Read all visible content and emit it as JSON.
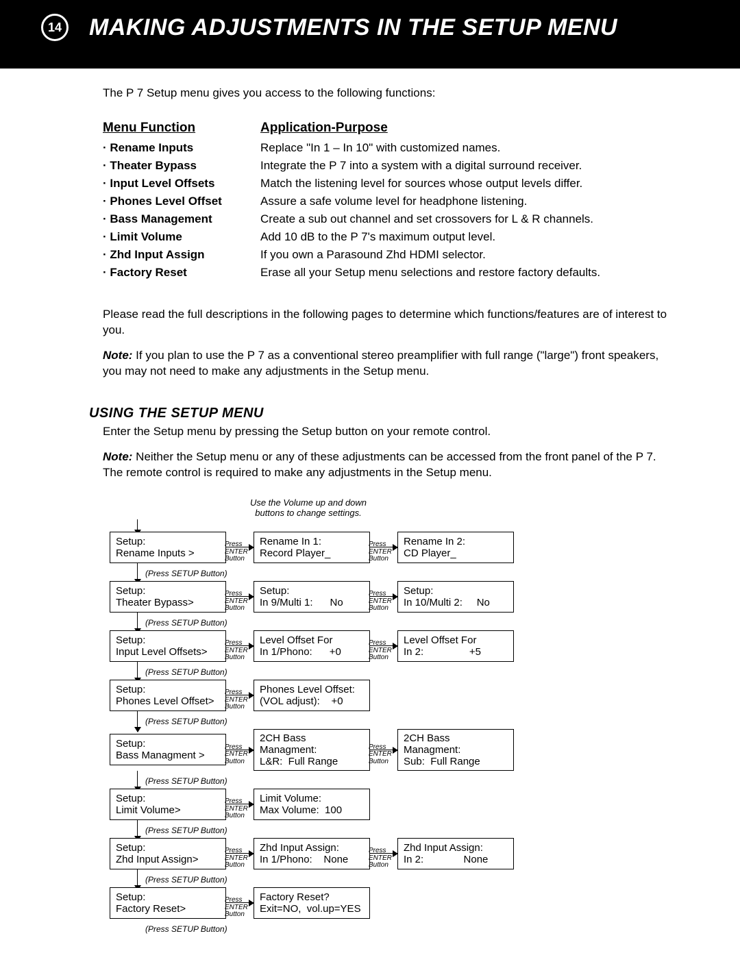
{
  "page_number": "14",
  "header_title": "MAKING ADJUSTMENTS IN THE SETUP MENU",
  "intro": "The P 7 Setup menu gives you access to the following functions:",
  "table": {
    "col1_header": "Menu Function",
    "col2_header": "Application-Purpose",
    "rows": [
      {
        "func": "· Rename Inputs",
        "purpose": "Replace \"In 1 – In 10\" with customized names."
      },
      {
        "func": "· Theater Bypass",
        "purpose": "Integrate the P 7 into a system with a digital surround receiver."
      },
      {
        "func": "· Input Level Offsets",
        "purpose": "Match the listening level for sources whose output levels differ."
      },
      {
        "func": "· Phones Level Offset",
        "purpose": "Assure a safe volume level for headphone listening."
      },
      {
        "func": "· Bass Management",
        "purpose": "Create a sub out channel and set crossovers for L & R channels."
      },
      {
        "func": "· Limit Volume",
        "purpose": "Add 10 dB to the P 7's maximum output level."
      },
      {
        "func": "· Zhd Input Assign",
        "purpose": "If you own a Parasound Zhd HDMI selector."
      },
      {
        "func": "· Factory Reset",
        "purpose": "Erase all your Setup menu selections and restore factory defaults."
      }
    ]
  },
  "para1": "Please read the full descriptions in the following pages to determine which functions/features are of interest to you.",
  "note1_label": "Note:",
  "note1_text": " If you plan to use the P 7 as a conventional stereo preamplifier with full range (\"large\") front speakers, you may not need to make any adjustments in the Setup menu.",
  "section2_heading": "USING THE SETUP MENU",
  "section2_p1": "Enter the Setup menu by pressing the Setup button on your remote control.",
  "note2_label": "Note:",
  "note2_text": " Neither the Setup menu or any of these adjustments can be accessed from the front panel of the P 7. The remote control is required to make any adjustments in the Setup menu.",
  "diagram": {
    "top_hint": "Use the Volume up and down buttons to change settings.",
    "enter_label_l1": "Press",
    "enter_label_l2": "ENTER",
    "enter_label_l3": "Button",
    "setup_label": "(Press SETUP Button)",
    "rows": [
      {
        "col1": {
          "l1": "Setup:",
          "l2": "Rename Inputs >"
        },
        "col2": {
          "l1": "Rename In 1:",
          "l2": "Record Player_"
        },
        "col3": {
          "l1": "Rename In 2:",
          "l2": "CD Player_"
        }
      },
      {
        "col1": {
          "l1": "Setup:",
          "l2": "Theater Bypass>"
        },
        "col2": {
          "l1": "Setup:",
          "l2": "In 9/Multi 1:      No"
        },
        "col3": {
          "l1": "Setup:",
          "l2": "In 10/Multi 2:     No"
        }
      },
      {
        "col1": {
          "l1": "Setup:",
          "l2": "Input Level Offsets>"
        },
        "col2": {
          "l1": "Level Offset For",
          "l2": "In 1/Phono:      +0"
        },
        "col3": {
          "l1": "Level Offset For",
          "l2": "In 2:                +5"
        }
      },
      {
        "col1": {
          "l1": "Setup:",
          "l2": "Phones Level Offset>"
        },
        "col2": {
          "l1": "Phones Level Offset:",
          "l2": "(VOL adjust):    +0"
        },
        "col3": null
      },
      {
        "col1": {
          "l1": "Setup:",
          "l2": "Bass Managment >"
        },
        "col2": {
          "l1": "2CH Bass Managment:",
          "l2": "L&R:  Full Range"
        },
        "col3": {
          "l1": "2CH Bass Managment:",
          "l2": "Sub:  Full Range"
        }
      },
      {
        "col1": {
          "l1": "Setup:",
          "l2": "Limit Volume>"
        },
        "col2": {
          "l1": "Limit Volume:",
          "l2": "Max Volume:  100"
        },
        "col3": null
      },
      {
        "col1": {
          "l1": "Setup:",
          "l2": "Zhd Input Assign>"
        },
        "col2": {
          "l1": "Zhd Input Assign:",
          "l2": "In 1/Phono:    None"
        },
        "col3": {
          "l1": "Zhd Input Assign:",
          "l2": "In 2:              None"
        }
      },
      {
        "col1": {
          "l1": "Setup:",
          "l2": "Factory Reset>"
        },
        "col2": {
          "l1": "Factory Reset?",
          "l2": "Exit=NO,  vol.up=YES"
        },
        "col3": null
      }
    ]
  }
}
